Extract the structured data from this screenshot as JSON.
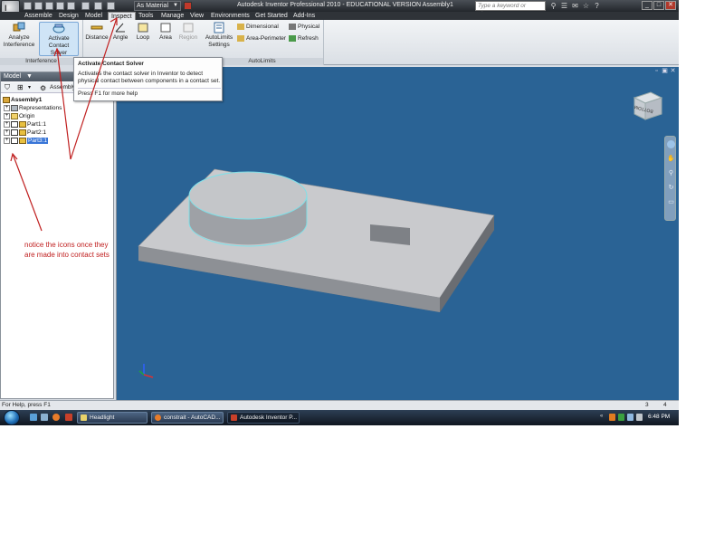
{
  "title_bar": {
    "material": "As Material",
    "window_title": "Autodesk Inventor Professional 2010 - EDUCATIONAL VERSION     Assembly1",
    "search_placeholder": "Type a keyword or phrase"
  },
  "tabs": [
    {
      "label": "Assemble"
    },
    {
      "label": "Design"
    },
    {
      "label": "Model"
    },
    {
      "label": "Inspect"
    },
    {
      "label": "Tools"
    },
    {
      "label": "Manage"
    },
    {
      "label": "View"
    },
    {
      "label": "Environments"
    },
    {
      "label": "Get Started"
    },
    {
      "label": "Add-Ins"
    }
  ],
  "active_tab": "Inspect",
  "ribbon": {
    "interference": {
      "title": "Interference",
      "analyze": "Analyze Interference",
      "activate": "Activate Contact Solver"
    },
    "measure": {
      "distance": "Distance",
      "angle": "Angle",
      "loop": "Loop",
      "area": "Area",
      "region": "Region"
    },
    "autolimits": {
      "title": "AutoLimits",
      "settings": "AutoLimits Settings",
      "dimensional": "Dimensional",
      "area_perimeter": "Area-Perimeter",
      "physical": "Physical",
      "refresh": "Refresh"
    }
  },
  "tooltip": {
    "title": "Activate Contact Solver",
    "description": "Activates the contact solver in Inventor to detect physical contact between components in a contact set.",
    "help": "Press F1 for more help"
  },
  "browser": {
    "header": "Model",
    "assembly_label": "Assembly View",
    "tree": {
      "root": "Assembly1",
      "representations": "Representations",
      "origin": "Origin",
      "part1": "Part1:1",
      "part2": "Part2:1",
      "part3": "Part3:1"
    }
  },
  "viewcube_label": "BOTTOM",
  "annotation": {
    "note": "notice the icons once they are made into contact sets"
  },
  "status_bar": {
    "help": "For Help, press F1",
    "count_a": "3",
    "count_b": "4"
  },
  "taskbar": {
    "tasks": [
      {
        "label": "Headlight"
      },
      {
        "label": "constrait - AutoCAD..."
      },
      {
        "label": "Autodesk Inventor P..."
      }
    ],
    "clock": "6:48 PM"
  },
  "colors": {
    "viewport_bg": "#2a6395",
    "annotation_red": "#c02020",
    "selection_blue": "#3875d7",
    "highlight_cyan": "#7fe0e8"
  }
}
